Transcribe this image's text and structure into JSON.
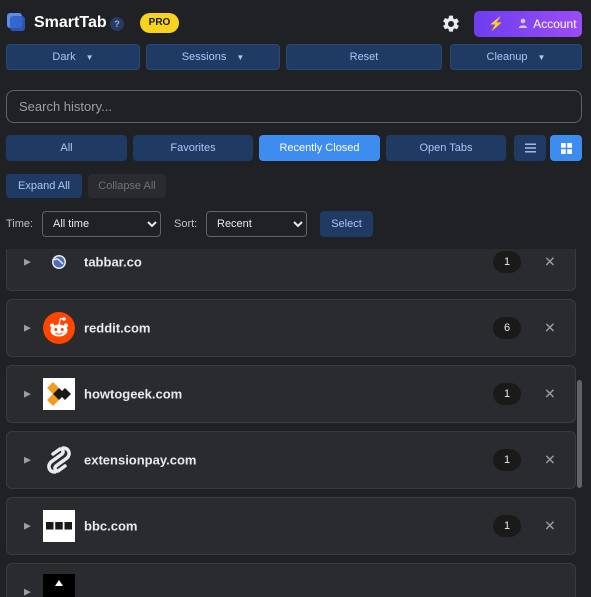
{
  "header": {
    "title": "SmartTab",
    "help": "?",
    "pro_badge": "PRO",
    "account_label": "Account"
  },
  "toolbar": {
    "theme": "Dark",
    "sessions": "Sessions",
    "reset": "Reset",
    "cleanup": "Cleanup"
  },
  "search": {
    "placeholder": "Search history..."
  },
  "filters": {
    "tabs": [
      "All",
      "Favorites",
      "Recently Closed",
      "Open Tabs"
    ],
    "active": "Recently Closed"
  },
  "controls": {
    "expand_all": "Expand All",
    "collapse_all": "Collapse All",
    "time_label": "Time:",
    "time_value": "All time",
    "sort_label": "Sort:",
    "sort_value": "Recent",
    "select": "Select"
  },
  "list": {
    "items": [
      {
        "domain": "tabbar.co",
        "count": "1",
        "icon": "globe-icon"
      },
      {
        "domain": "reddit.com",
        "count": "6",
        "icon": "reddit-icon"
      },
      {
        "domain": "howtogeek.com",
        "count": "1",
        "icon": "howtogeek-icon"
      },
      {
        "domain": "extensionpay.com",
        "count": "1",
        "icon": "extensionpay-icon"
      },
      {
        "domain": "bbc.com",
        "count": "1",
        "icon": "bbc-icon"
      }
    ]
  },
  "colors": {
    "background": "#202124",
    "primary": "#3d8cf0",
    "button": "#1f3a63",
    "pro": "#f7d21e",
    "account": "#7c45f2"
  }
}
